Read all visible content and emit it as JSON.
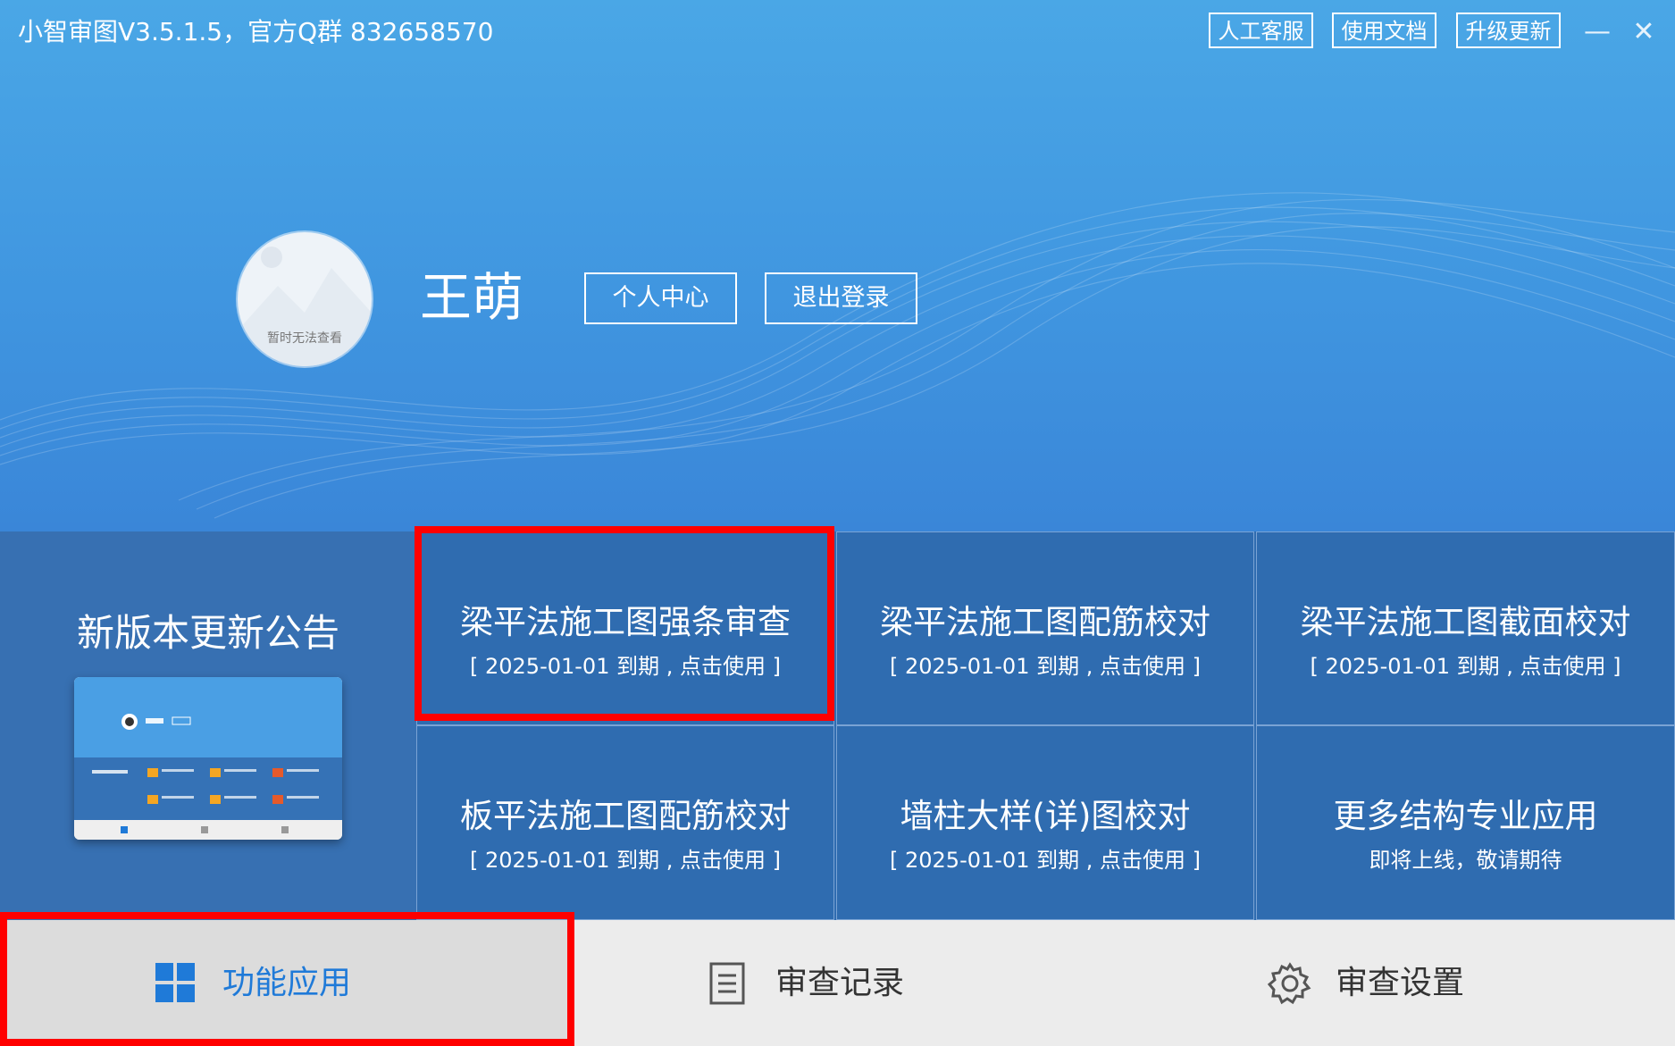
{
  "window": {
    "title": "小智审图V3.5.1.5，官方Q群 832658570",
    "buttons": {
      "service": "人工客服",
      "docs": "使用文档",
      "update": "升级更新"
    },
    "minimize_glyph": "—",
    "close_glyph": "✕"
  },
  "user": {
    "name": "王萌",
    "avatar_caption": "暂时无法查看",
    "personal_center": "个人中心",
    "logout": "退出登录"
  },
  "notice": {
    "title": "新版本更新公告"
  },
  "tiles": [
    {
      "title": "梁平法施工图强条审查",
      "subtitle": "[ 2025-01-01  到期 , 点击使用 ]"
    },
    {
      "title": "梁平法施工图配筋校对",
      "subtitle": "[ 2025-01-01  到期 , 点击使用 ]"
    },
    {
      "title": "梁平法施工图截面校对",
      "subtitle": "[ 2025-01-01  到期 , 点击使用 ]"
    },
    {
      "title": "板平法施工图配筋校对",
      "subtitle": "[ 2025-01-01  到期 , 点击使用 ]"
    },
    {
      "title": "墙柱大样(详)图校对",
      "subtitle": "[ 2025-01-01  到期 , 点击使用 ]"
    },
    {
      "title": "更多结构专业应用",
      "subtitle": "即将上线，敬请期待"
    }
  ],
  "tabs": [
    {
      "label": "功能应用",
      "icon": "windows-grid-icon",
      "active": true
    },
    {
      "label": "审查记录",
      "icon": "document-icon",
      "active": false
    },
    {
      "label": "审查设置",
      "icon": "gear-icon",
      "active": false
    }
  ],
  "colors": {
    "header": "#4096e0",
    "grid": "#2f6cb0",
    "active_tab_text": "#1f7ad8",
    "highlight": "#ff0000"
  }
}
